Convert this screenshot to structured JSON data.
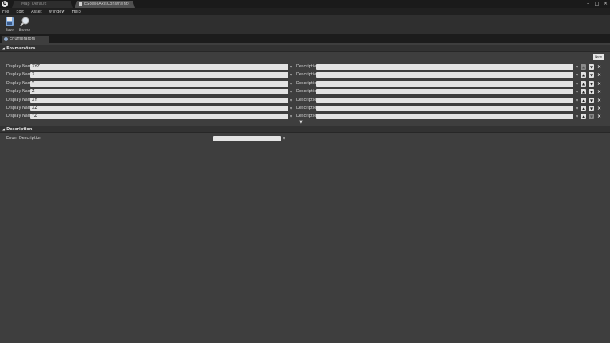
{
  "titlebar": {
    "tabs": [
      {
        "label": "Map_Default"
      },
      {
        "label": "ESceneAxisConstraint"
      }
    ],
    "close_glyph": "×",
    "window_controls": [
      "–",
      "□",
      "×"
    ]
  },
  "menu": [
    "File",
    "Edit",
    "Asset",
    "Window",
    "Help"
  ],
  "toolbar": {
    "save_label": "Save",
    "browse_label": "Browse"
  },
  "panel_tab": {
    "label": "Enumerators"
  },
  "enumerators_section": {
    "title": "Enumerators",
    "new_label": "New",
    "rows": [
      {
        "display_name_label": "Display Name",
        "value": "XYZ",
        "description_label": "Description",
        "up_enabled": false,
        "down_enabled": true
      },
      {
        "display_name_label": "Display Name",
        "value": "X",
        "description_label": "Description",
        "up_enabled": true,
        "down_enabled": true
      },
      {
        "display_name_label": "Display Name",
        "value": "Y",
        "description_label": "Description",
        "up_enabled": true,
        "down_enabled": true
      },
      {
        "display_name_label": "Display Name",
        "value": "Z",
        "description_label": "Description",
        "up_enabled": true,
        "down_enabled": true
      },
      {
        "display_name_label": "Display Name",
        "value": "XY",
        "description_label": "Description",
        "up_enabled": true,
        "down_enabled": true
      },
      {
        "display_name_label": "Display Name",
        "value": "XZ",
        "description_label": "Description",
        "up_enabled": true,
        "down_enabled": true
      },
      {
        "display_name_label": "Display Name",
        "value": "YZ",
        "description_label": "Description",
        "up_enabled": true,
        "down_enabled": false
      }
    ]
  },
  "description_section": {
    "title": "Description",
    "enum_description_label": "Enum Description",
    "enum_description_value": ""
  },
  "colors": {
    "background": "#3e3e3e",
    "titlebar": "#1a1a1a",
    "field": "#e3e3e3"
  }
}
